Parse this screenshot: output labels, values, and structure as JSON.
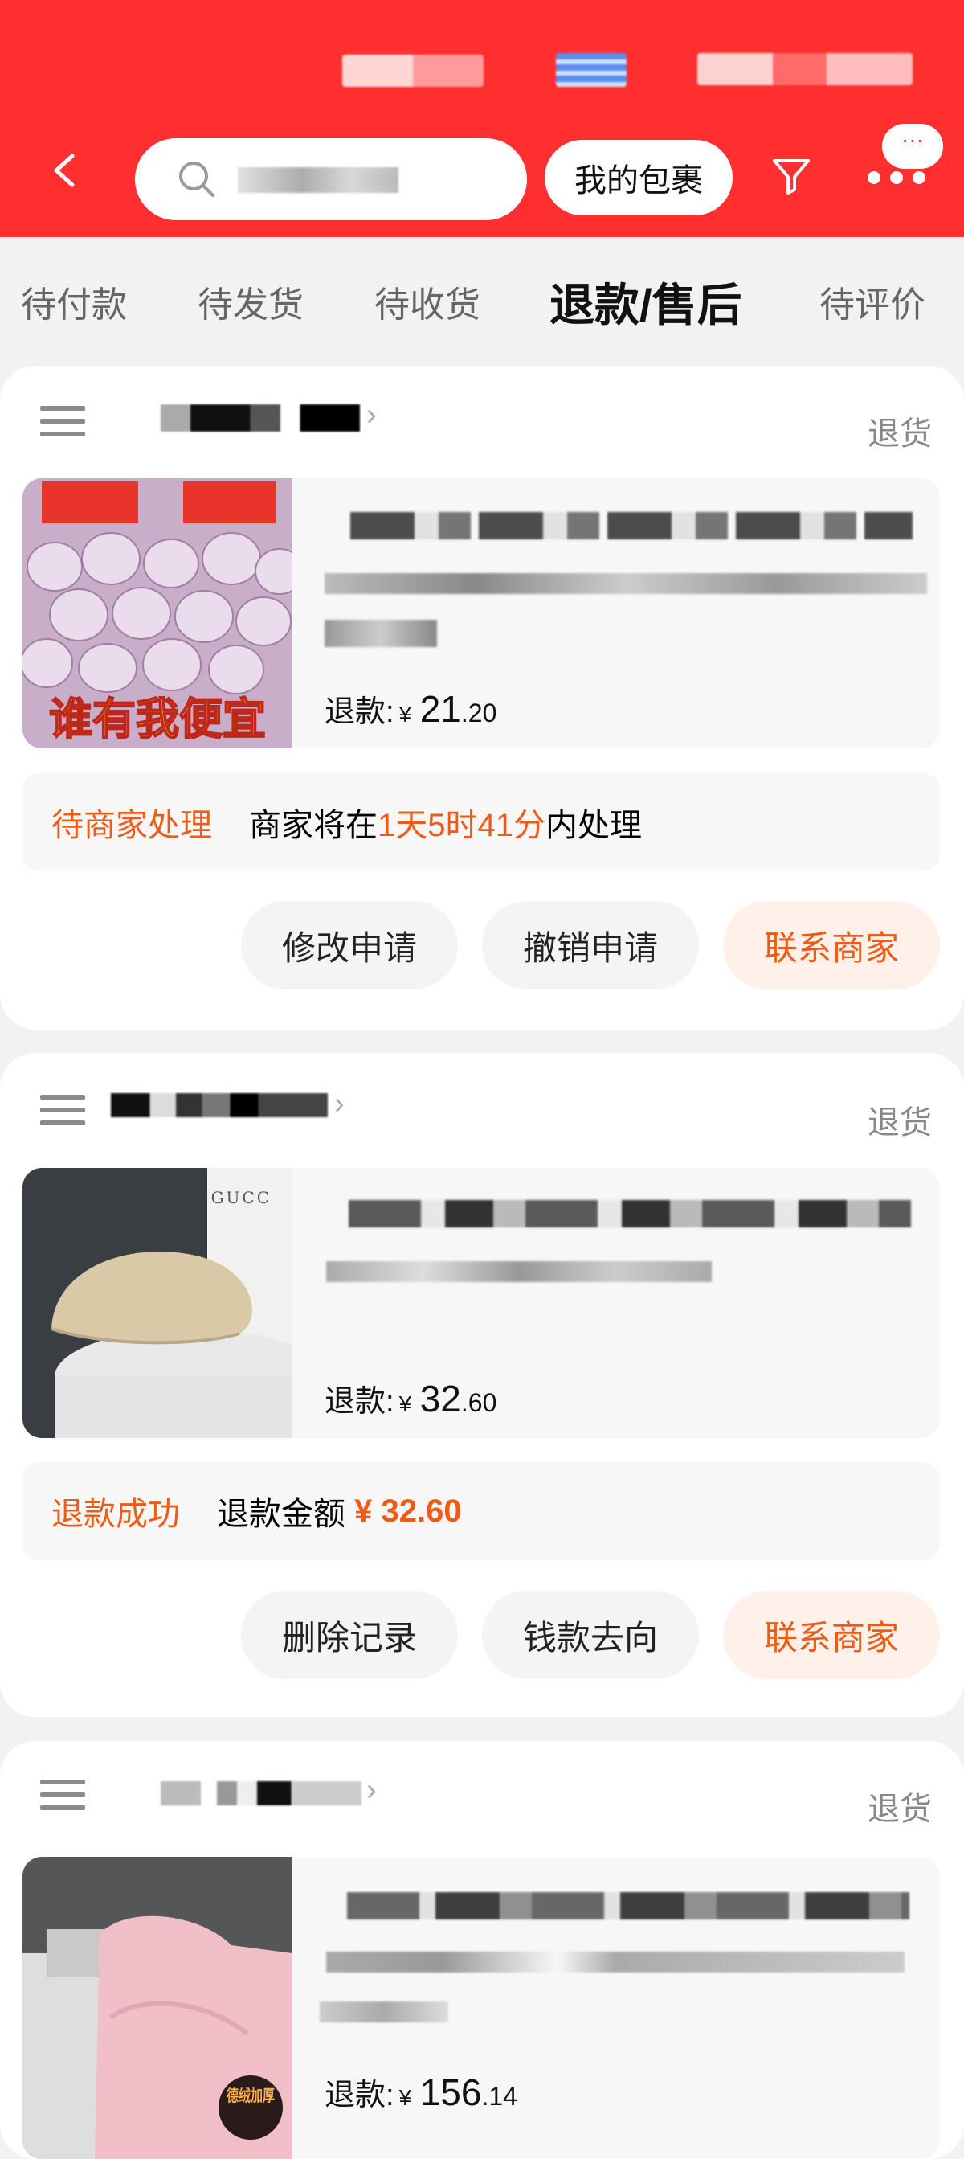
{
  "header": {
    "back_icon": "chevron-left-icon",
    "search_icon": "search-icon",
    "my_packages_label": "我的包裹",
    "filter_icon": "filter-icon",
    "more_icon": "more-dots-icon",
    "message_badge": "···",
    "colors": {
      "bar": "#ff2f2f"
    }
  },
  "tabs": [
    {
      "label": "待付款"
    },
    {
      "label": "待发货"
    },
    {
      "label": "待收货"
    },
    {
      "label": "退款/售后",
      "active": true
    },
    {
      "label": "待评价"
    }
  ],
  "orders": [
    {
      "type_label": "退货",
      "thumb_caption": "谁有我便宜",
      "refund_prefix": "退款:",
      "currency": "¥",
      "amount_int": "21",
      "amount_dec": ".20",
      "status_label": "待商家处理",
      "status_text_before": "商家将在",
      "status_highlight": "1天5时41分",
      "status_text_after": "内处理",
      "buttons": [
        "修改申请",
        "撤销申请",
        "联系商家"
      ]
    },
    {
      "type_label": "退货",
      "thumb_caption": "GUCC",
      "refund_prefix": "退款:",
      "currency": "¥",
      "amount_int": "32",
      "amount_dec": ".60",
      "status_label": "退款成功",
      "status_text_before": "退款金额",
      "status_highlight": "¥ 32.60",
      "buttons": [
        "删除记录",
        "钱款去向",
        "联系商家"
      ]
    },
    {
      "type_label": "退货",
      "thumb_caption": "德绒加厚",
      "refund_prefix": "退款:",
      "currency": "¥",
      "amount_int": "156",
      "amount_dec": ".14"
    }
  ],
  "colors": {
    "accent": "#ef5a16",
    "page_bg": "#f2f2f2"
  }
}
